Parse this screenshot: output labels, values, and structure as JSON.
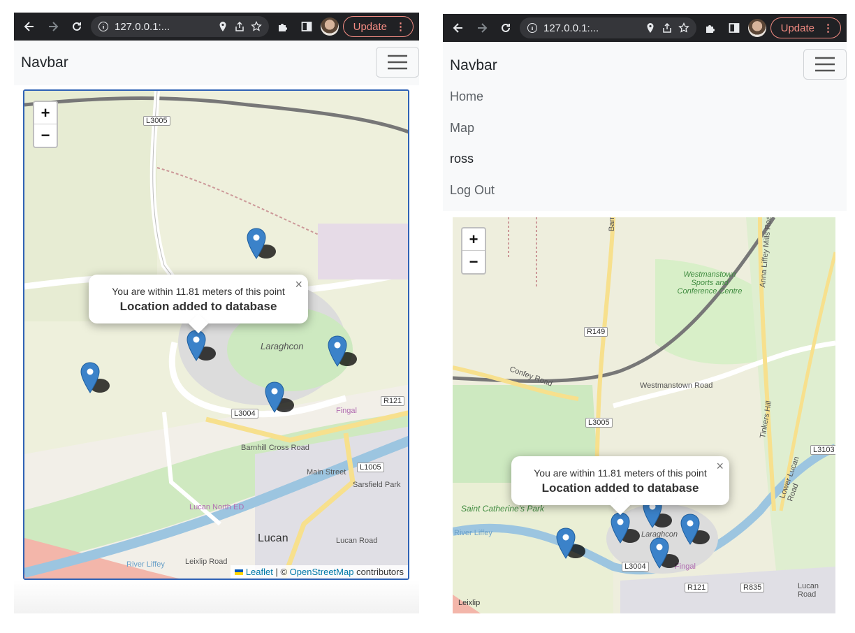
{
  "left": {
    "address": "127.0.0.1:...",
    "update_label": "Update",
    "brand": "Navbar",
    "popup_line1": "You are within 11.81 meters of this point",
    "popup_line2": "Location added to database",
    "zoom_in": "+",
    "zoom_out": "−",
    "attribution": {
      "leaflet": "Leaflet",
      "sep": " | © ",
      "osm": "OpenStreetMap",
      "suffix": " contributors"
    },
    "map_labels": [
      "L3005",
      "L3004",
      "R121",
      "L1005",
      "Laraghcon",
      "Lucan",
      "Main Street",
      "Lucan Road",
      "Leixlip Road",
      "River Liffey",
      "Lucan North ED",
      "Barnhill Cross Road",
      "Sarsfield Park",
      "Fingal"
    ]
  },
  "right": {
    "address": "127.0.0.1:...",
    "update_label": "Update",
    "brand": "Navbar",
    "nav_items": [
      "Home",
      "Map",
      "ross",
      "Log Out"
    ],
    "popup_line1": "You are within 11.81 meters of this point",
    "popup_line2": "Location added to database",
    "zoom_in": "+",
    "zoom_out": "−",
    "map_labels": [
      "Barnhill Road",
      "R149",
      "Confey Road",
      "Westmanstown Road",
      "L3005",
      "Westmanstown Sports and Conference Centre",
      "Anna Liffey Mills Road",
      "Tinkers Hill",
      "Lower Lucan Road",
      "L3103",
      "Saint Catherine's Park",
      "River Liffey",
      "Laraghcon",
      "L3004",
      "R121",
      "R835",
      "Lucan Road",
      "Leixlip",
      "Fingal"
    ]
  },
  "colors": {
    "marker": "#3b82c9",
    "accent_update": "#f28b82",
    "map_border": "#2f62b5"
  }
}
